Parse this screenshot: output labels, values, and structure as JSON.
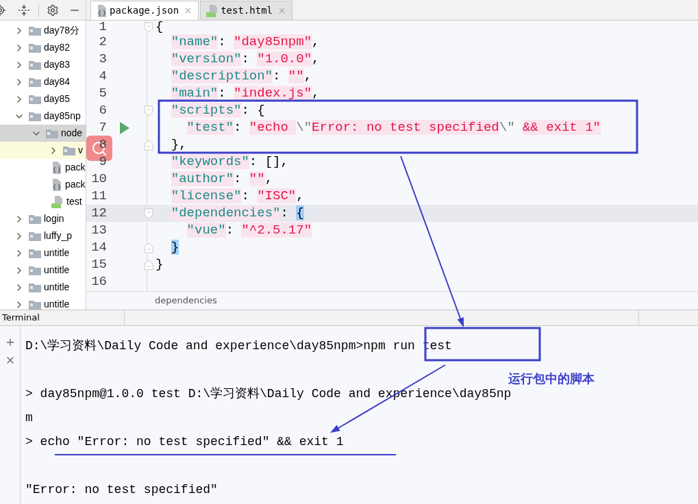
{
  "sidebar": {
    "items": [
      {
        "label": "day78分",
        "kind": "folder",
        "expanded": false,
        "selected": false,
        "highlighted": false
      },
      {
        "label": "day82",
        "kind": "folder",
        "expanded": false,
        "selected": false,
        "highlighted": false
      },
      {
        "label": "day83",
        "kind": "folder",
        "expanded": false,
        "selected": false,
        "highlighted": false
      },
      {
        "label": "day84",
        "kind": "folder",
        "expanded": false,
        "selected": false,
        "highlighted": false
      },
      {
        "label": "day85",
        "kind": "folder",
        "expanded": false,
        "selected": false,
        "highlighted": false
      },
      {
        "label": "day85np",
        "kind": "folder",
        "expanded": true,
        "selected": false,
        "highlighted": false,
        "children": [
          {
            "label": "node",
            "kind": "folder",
            "expanded": true,
            "selected": true,
            "highlighted": false,
            "children": [
              {
                "label": "v",
                "kind": "folder",
                "expanded": false,
                "selected": false,
                "highlighted": true
              }
            ]
          },
          {
            "label": "pack",
            "kind": "json",
            "selected": false,
            "highlighted": false
          },
          {
            "label": "pack",
            "kind": "json",
            "selected": false,
            "highlighted": false
          },
          {
            "label": "test",
            "kind": "html",
            "selected": false,
            "highlighted": false
          }
        ]
      },
      {
        "label": "login",
        "kind": "folder",
        "expanded": false,
        "selected": false,
        "highlighted": false
      },
      {
        "label": "luffy_p",
        "kind": "folder",
        "expanded": false,
        "selected": false,
        "highlighted": false
      },
      {
        "label": "untitle",
        "kind": "folder",
        "expanded": false,
        "selected": false,
        "highlighted": false
      },
      {
        "label": "untitle",
        "kind": "folder",
        "expanded": false,
        "selected": false,
        "highlighted": false
      },
      {
        "label": "untitle",
        "kind": "folder",
        "expanded": false,
        "selected": false,
        "highlighted": false
      },
      {
        "label": "untitle",
        "kind": "folder",
        "expanded": false,
        "selected": false,
        "highlighted": false
      }
    ]
  },
  "tabs": [
    {
      "label": "package.json",
      "kind": "json",
      "selected": true
    },
    {
      "label": "test.html",
      "kind": "html",
      "selected": false
    }
  ],
  "editor": {
    "lines": [
      {
        "number": "1",
        "fold_start": true,
        "fold_end": false,
        "run": false,
        "current": false,
        "tokens": [
          {
            "kind": "punct",
            "text": "{"
          }
        ]
      },
      {
        "number": "2",
        "fold_start": false,
        "fold_end": false,
        "run": false,
        "current": false,
        "tokens": [
          {
            "kind": "key",
            "text": "  \"name\""
          },
          {
            "kind": "punct",
            "text": ": "
          },
          {
            "kind": "string",
            "text": "\"day85npm\""
          },
          {
            "kind": "punct",
            "text": ","
          }
        ]
      },
      {
        "number": "3",
        "fold_start": false,
        "fold_end": false,
        "run": false,
        "current": false,
        "tokens": [
          {
            "kind": "key",
            "text": "  \"version\""
          },
          {
            "kind": "punct",
            "text": ": "
          },
          {
            "kind": "string",
            "text": "\"1.0.0\""
          },
          {
            "kind": "punct",
            "text": ","
          }
        ]
      },
      {
        "number": "4",
        "fold_start": false,
        "fold_end": false,
        "run": false,
        "current": false,
        "tokens": [
          {
            "kind": "key",
            "text": "  \"description\""
          },
          {
            "kind": "punct",
            "text": ": "
          },
          {
            "kind": "string",
            "text": "\"\""
          },
          {
            "kind": "punct",
            "text": ","
          }
        ]
      },
      {
        "number": "5",
        "fold_start": false,
        "fold_end": false,
        "run": false,
        "current": false,
        "tokens": [
          {
            "kind": "key",
            "text": "  \"main\""
          },
          {
            "kind": "punct",
            "text": ": "
          },
          {
            "kind": "string",
            "text": "\"index.js\""
          },
          {
            "kind": "punct",
            "text": ","
          }
        ]
      },
      {
        "number": "6",
        "fold_start": true,
        "fold_end": false,
        "run": false,
        "current": false,
        "tokens": [
          {
            "kind": "key",
            "text": "  \"scripts\""
          },
          {
            "kind": "punct",
            "text": ": {"
          }
        ]
      },
      {
        "number": "7",
        "fold_start": false,
        "fold_end": false,
        "run": true,
        "current": false,
        "tokens": [
          {
            "kind": "key",
            "text": "    \"test\""
          },
          {
            "kind": "punct",
            "text": ": "
          },
          {
            "kind": "string",
            "text": "\"echo "
          },
          {
            "kind": "escape",
            "text": "\\\""
          },
          {
            "kind": "string",
            "text": "Error: no test specified"
          },
          {
            "kind": "escape",
            "text": "\\\""
          },
          {
            "kind": "string",
            "text": " && exit 1\""
          }
        ]
      },
      {
        "number": "8",
        "fold_start": false,
        "fold_end": true,
        "run": false,
        "current": false,
        "tokens": [
          {
            "kind": "punct",
            "text": "  },"
          }
        ]
      },
      {
        "number": "9",
        "fold_start": false,
        "fold_end": false,
        "run": false,
        "current": false,
        "tokens": [
          {
            "kind": "key",
            "text": "  \"keywords\""
          },
          {
            "kind": "punct",
            "text": ": [],"
          }
        ]
      },
      {
        "number": "10",
        "fold_start": false,
        "fold_end": false,
        "run": false,
        "current": false,
        "tokens": [
          {
            "kind": "key",
            "text": "  \"author\""
          },
          {
            "kind": "punct",
            "text": ": "
          },
          {
            "kind": "string",
            "text": "\"\""
          },
          {
            "kind": "punct",
            "text": ","
          }
        ]
      },
      {
        "number": "11",
        "fold_start": false,
        "fold_end": false,
        "run": false,
        "current": false,
        "tokens": [
          {
            "kind": "key",
            "text": "  \"license\""
          },
          {
            "kind": "punct",
            "text": ": "
          },
          {
            "kind": "string",
            "text": "\"ISC\""
          },
          {
            "kind": "punct",
            "text": ","
          }
        ]
      },
      {
        "number": "12",
        "fold_start": true,
        "fold_end": false,
        "run": false,
        "current": true,
        "tokens": [
          {
            "kind": "key",
            "text": "  \"dependencies\""
          },
          {
            "kind": "punct",
            "text": ": "
          },
          {
            "kind": "brace",
            "text": "{"
          }
        ]
      },
      {
        "number": "13",
        "fold_start": false,
        "fold_end": false,
        "run": false,
        "current": false,
        "tokens": [
          {
            "kind": "key",
            "text": "    \"vue\""
          },
          {
            "kind": "punct",
            "text": ": "
          },
          {
            "kind": "string",
            "text": "\"^2.5.17\""
          }
        ]
      },
      {
        "number": "14",
        "fold_start": false,
        "fold_end": true,
        "run": false,
        "current": false,
        "tokens": [
          {
            "kind": "brace",
            "text": "  }"
          }
        ]
      },
      {
        "number": "15",
        "fold_start": false,
        "fold_end": true,
        "run": false,
        "current": false,
        "tokens": [
          {
            "kind": "punct",
            "text": "}"
          }
        ]
      },
      {
        "number": "16",
        "fold_start": false,
        "fold_end": false,
        "run": false,
        "current": false
      }
    ],
    "breadcrumb": "dependencies"
  },
  "terminal": {
    "title": "Terminal",
    "blocks": [
      [
        {
          "prompt": "D:\\学习资料\\Daily Code and experience\\day85npm>",
          "command": "npm run test"
        }
      ],
      [
        {
          "text": "> day85npm@1.0.0 test D:\\学习资料\\Daily Code and experience\\day85np"
        },
        {
          "text": "m"
        },
        {
          "text": "> echo \"Error: no test specified\" && exit 1"
        }
      ],
      [
        {
          "text": "\"Error: no test specified\""
        }
      ]
    ]
  },
  "annotation": {
    "note": "运行包中的脚本"
  }
}
